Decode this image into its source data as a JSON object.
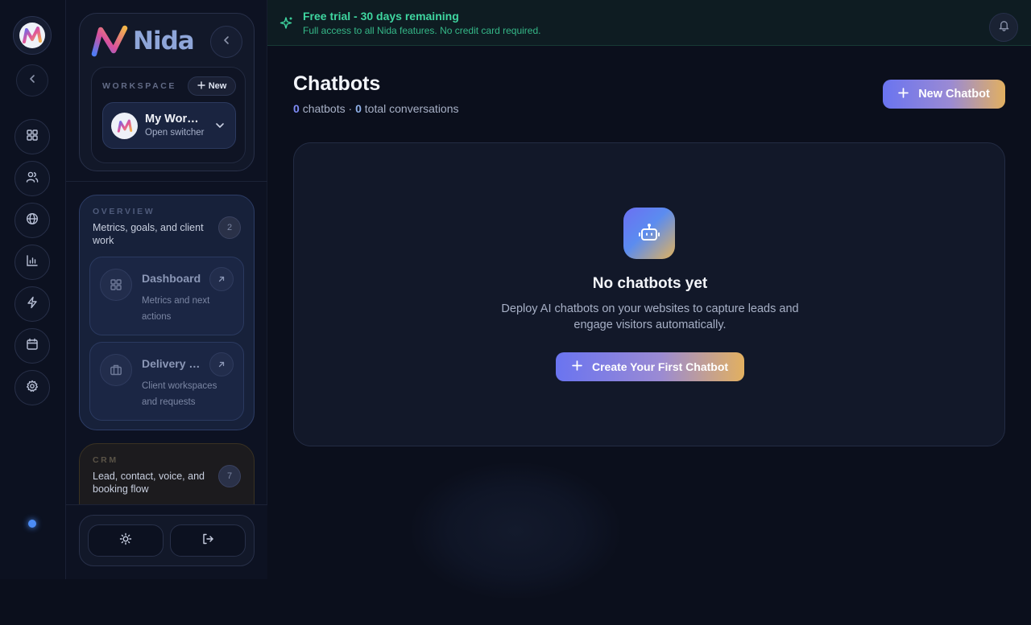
{
  "brand": {
    "name": "Nida"
  },
  "workspace": {
    "label": "WORKSPACE",
    "new_label": "New",
    "name": "My Workspace",
    "switch_hint": "Open switcher"
  },
  "rail": {
    "icons": [
      "grid-icon",
      "users-icon",
      "globe-icon",
      "bar-chart-icon",
      "bolt-icon",
      "calendar-icon",
      "settings-icon"
    ]
  },
  "sections": {
    "overview": {
      "label": "OVERVIEW",
      "description": "Metrics, goals, and client work",
      "count": "2",
      "items": [
        {
          "title": "Dashboard",
          "description": "Metrics and next actions"
        },
        {
          "title": "Delivery Hub",
          "description": "Client workspaces and requests"
        }
      ]
    },
    "crm": {
      "label": "CRM",
      "description": "Lead, contact, voice, and booking flow",
      "count": "7"
    }
  },
  "banner": {
    "title": "Free trial - 30 days remaining",
    "subtitle": "Full access to all Nida features. No credit card required."
  },
  "page": {
    "title": "Chatbots",
    "chatbot_count": "0",
    "chatbots_word": "chatbots",
    "separator": "·",
    "conversation_count": "0",
    "conversations_word": "total conversations",
    "new_button": "New Chatbot"
  },
  "empty_state": {
    "title": "No chatbots yet",
    "description": "Deploy AI chatbots on your websites to capture leads and engage visitors automatically.",
    "cta": "Create Your First Chatbot"
  },
  "colors": {
    "accent_start": "#6a74f0",
    "accent_end": "#e2b060",
    "trial_green": "#3fd6a0",
    "background": "#0b0f1c"
  }
}
